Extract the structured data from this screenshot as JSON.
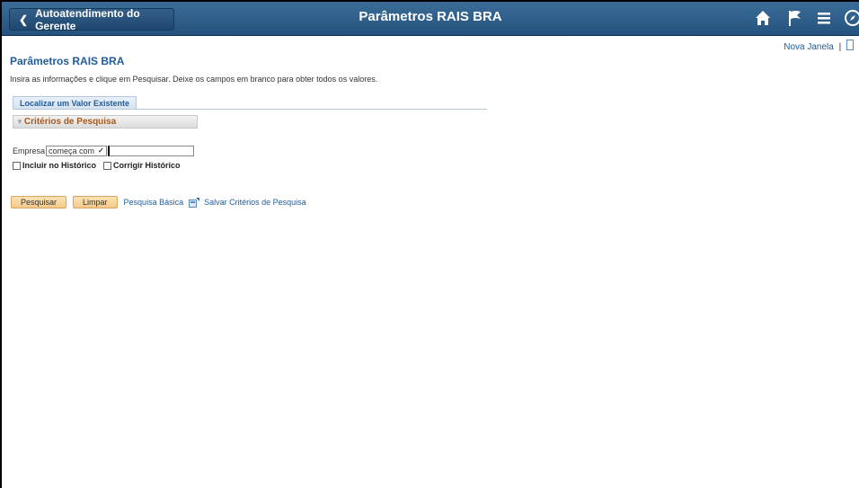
{
  "banner": {
    "back_label": "Autoatendimento do Gerente",
    "title": "Parâmetros RAIS BRA",
    "icons": [
      "home-icon",
      "flag-icon",
      "menu-icon",
      "compass-icon"
    ]
  },
  "top_links": {
    "new_window": "Nova Janela",
    "separator": "|"
  },
  "page": {
    "title": "Parâmetros RAIS BRA",
    "instructions": "Insira as informações e clique em Pesquisar. Deixe os campos em branco para obter todos os valores."
  },
  "tab": {
    "label": "Localizar um Valor Existente"
  },
  "criteria": {
    "header": "Critérios de Pesquisa",
    "field_label": "Empresa",
    "operator_value": "começa com",
    "value": "",
    "include_history": "Incluir no Histórico",
    "correct_history": "Corrigir Histórico"
  },
  "actions": {
    "search": "Pesquisar",
    "clear": "Limpar",
    "basic_search": "Pesquisa Básica",
    "save_criteria": "Salvar Critérios de Pesquisa"
  },
  "colors": {
    "banner": "#2c5f8d",
    "link": "#1f5c99",
    "button": "#f4c98a",
    "criteria_text": "#a9581b"
  }
}
